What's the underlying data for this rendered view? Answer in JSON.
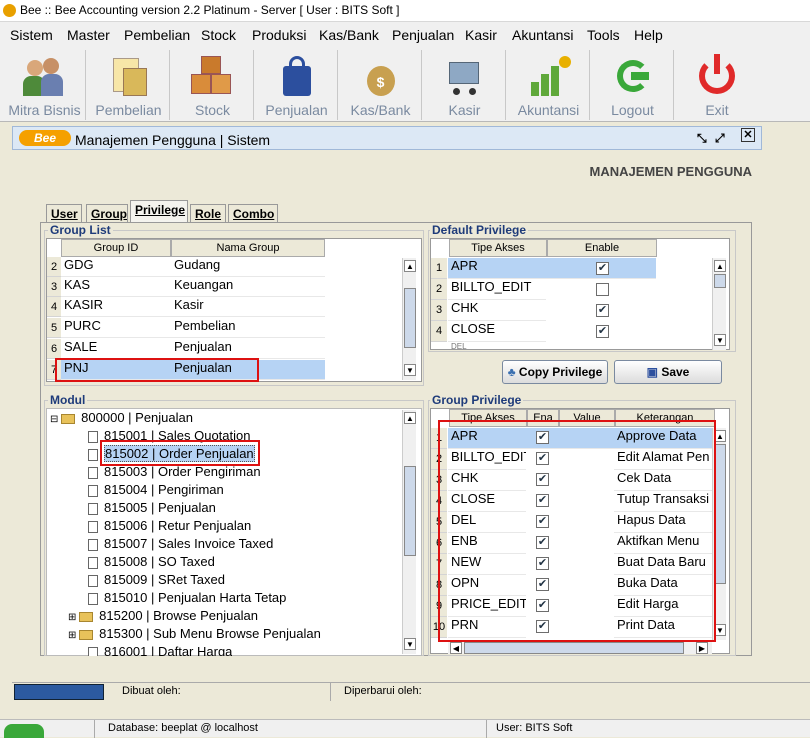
{
  "app": {
    "title": "Bee :: Bee Accounting version 2.2 Platinum - Server  [ User : BITS Soft ]"
  },
  "menu": [
    "Sistem",
    "Master",
    "Pembelian",
    "Stock",
    "Produksi",
    "Kas/Bank",
    "Penjualan",
    "Kasir",
    "Akuntansi",
    "Tools",
    "Help"
  ],
  "toolbar": [
    "Mitra Bisnis",
    "Pembelian",
    "Stock",
    "Penjualan",
    "Kas/Bank",
    "Kasir",
    "Akuntansi",
    "Logout",
    "Exit"
  ],
  "window": {
    "title": "Manajemen Pengguna | Sistem",
    "logo": "Bee",
    "heading": "MANAJEMEN PENGGUNA"
  },
  "tabs": [
    "User",
    "Group",
    "Privilege",
    "Role",
    "Combo"
  ],
  "group_list": {
    "title": "Group List",
    "headers": [
      "Group ID",
      "Nama Group"
    ],
    "rows": [
      {
        "n": "2",
        "id": "GDG",
        "name": "Gudang"
      },
      {
        "n": "3",
        "id": "KAS",
        "name": "Keuangan"
      },
      {
        "n": "4",
        "id": "KASIR",
        "name": "Kasir"
      },
      {
        "n": "5",
        "id": "PURC",
        "name": "Pembelian"
      },
      {
        "n": "6",
        "id": "SALE",
        "name": "Penjualan"
      },
      {
        "n": "7",
        "id": "PNJ",
        "name": "Penjualan"
      }
    ]
  },
  "default_privilege": {
    "title": "Default Privilege",
    "headers": [
      "Tipe Akses",
      "Enable"
    ],
    "rows": [
      {
        "n": "1",
        "akses": "APR",
        "en": true
      },
      {
        "n": "2",
        "akses": "BILLTO_EDIT",
        "en": false
      },
      {
        "n": "3",
        "akses": "CHK",
        "en": true
      },
      {
        "n": "4",
        "akses": "CLOSE",
        "en": true
      },
      {
        "n": "5",
        "akses": "DEL",
        "en": true
      }
    ]
  },
  "buttons": {
    "copy": "Copy Privilege",
    "save": "Save"
  },
  "modul": {
    "title": "Modul",
    "root": "800000 | Penjualan",
    "items": [
      "815001 | Sales Quotation",
      "815002 | Order Penjualan",
      "815003 | Order Pengiriman",
      "815004 | Pengiriman",
      "815005 | Penjualan",
      "815006 | Retur Penjualan",
      "815007 | Sales Invoice Taxed",
      "815008 | SO Taxed",
      "815009 | SRet Taxed",
      "815010 | Penjualan Harta Tetap",
      "815200 | Browse Penjualan",
      "815300 | Sub Menu Browse Penjualan",
      "816001 | Daftar Harga"
    ]
  },
  "group_privilege": {
    "title": "Group Privilege",
    "headers": [
      "Tipe Akses",
      "Ena",
      "Value",
      "Keterangan"
    ],
    "rows": [
      {
        "n": "1",
        "akses": "APR",
        "ket": "Approve Data"
      },
      {
        "n": "2",
        "akses": "BILLTO_EDIT",
        "ket": "Edit Alamat Pen"
      },
      {
        "n": "3",
        "akses": "CHK",
        "ket": "Cek Data"
      },
      {
        "n": "4",
        "akses": "CLOSE",
        "ket": "Tutup Transaksi"
      },
      {
        "n": "5",
        "akses": "DEL",
        "ket": "Hapus Data"
      },
      {
        "n": "6",
        "akses": "ENB",
        "ket": "Aktifkan Menu"
      },
      {
        "n": "7",
        "akses": "NEW",
        "ket": "Buat Data Baru"
      },
      {
        "n": "8",
        "akses": "OPN",
        "ket": "Buka Data"
      },
      {
        "n": "9",
        "akses": "PRICE_EDIT",
        "ket": "Edit Harga"
      },
      {
        "n": "10",
        "akses": "PRN",
        "ket": "Print Data"
      }
    ]
  },
  "status": {
    "dibuat": "Dibuat oleh:",
    "diperbarui": "Diperbarui oleh:",
    "database": "Database: beeplat @ localhost",
    "user": "User: BITS Soft"
  }
}
